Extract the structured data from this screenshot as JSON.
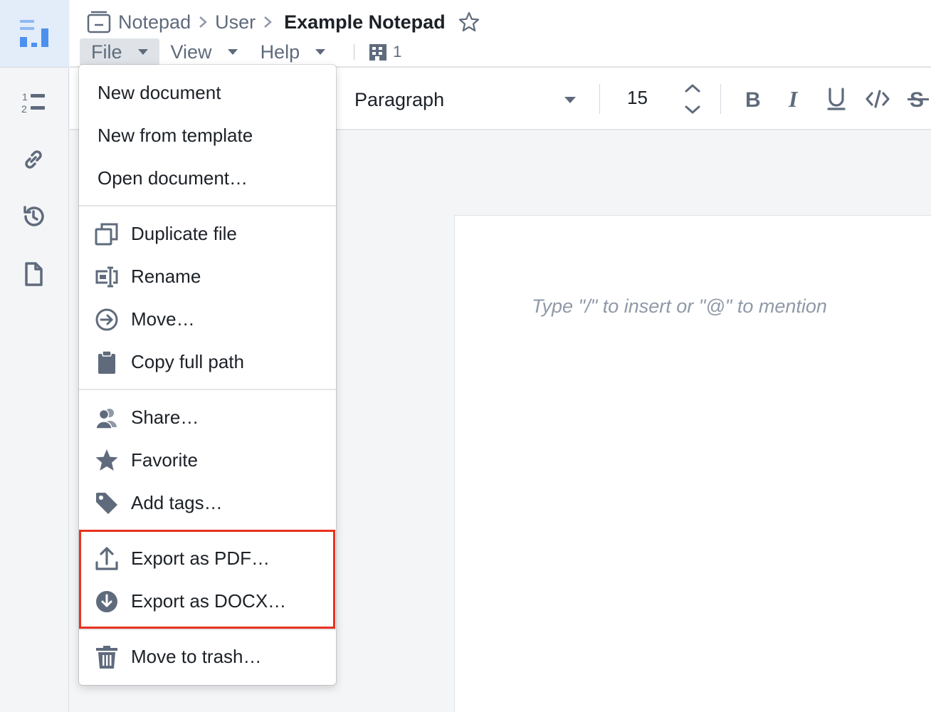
{
  "breadcrumb": {
    "items": [
      "Notepad",
      "User"
    ],
    "current": "Example Notepad"
  },
  "menubar": {
    "file": "File",
    "view": "View",
    "help": "Help",
    "org_count": "1"
  },
  "toolbar": {
    "paragraph": "Paragraph",
    "font_size": "15"
  },
  "editor": {
    "placeholder": "Type \"/\" to insert or \"@\" to mention"
  },
  "file_menu": {
    "new_document": "New document",
    "new_from_template": "New from template",
    "open_document": "Open document…",
    "duplicate_file": "Duplicate file",
    "rename": "Rename",
    "move": "Move…",
    "copy_full_path": "Copy full path",
    "share": "Share…",
    "favorite": "Favorite",
    "add_tags": "Add tags…",
    "export_pdf": "Export as PDF…",
    "export_docx": "Export as DOCX…",
    "move_to_trash": "Move to trash…"
  },
  "colors": {
    "accent": "#4c90f0",
    "highlight_border": "#e8321f",
    "icon_gray": "#5f6b7c"
  }
}
